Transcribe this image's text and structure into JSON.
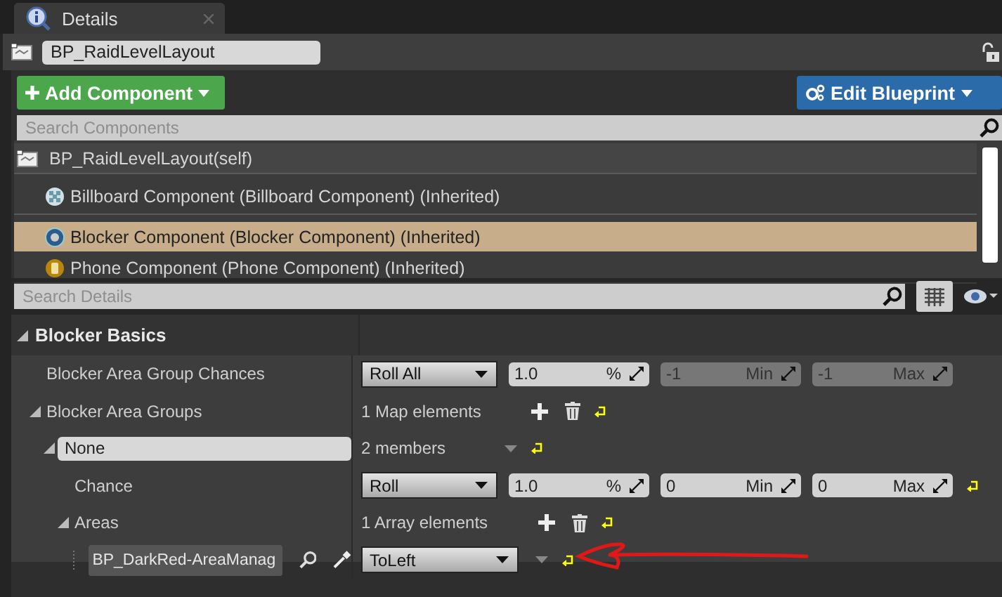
{
  "tab": {
    "title": "Details"
  },
  "actor": {
    "name": "BP_RaidLevelLayout"
  },
  "toolbar": {
    "add_button": "Add Component",
    "edit_button": "Edit Blueprint"
  },
  "component_search": {
    "placeholder": "Search Components"
  },
  "components": [
    {
      "kind": "root",
      "label": "BP_RaidLevelLayout(self)",
      "selected": false
    },
    {
      "kind": "billboard",
      "label": "Billboard Component (Billboard Component) (Inherited)",
      "selected": false
    },
    {
      "kind": "blocker",
      "label": "Blocker Component (Blocker Component) (Inherited)",
      "selected": true
    },
    {
      "kind": "phone",
      "label": "Phone Component (Phone Component) (Inherited)",
      "selected": false
    }
  ],
  "details_search": {
    "placeholder": "Search Details"
  },
  "category": {
    "label": "Blocker Basics",
    "expanded": true
  },
  "properties": [
    {
      "kind": "chances",
      "label": "Blocker Area Group Chances",
      "dropdown": "Roll All",
      "fields": [
        {
          "value": "1.0",
          "unit": "%",
          "disabled": false
        },
        {
          "value": "-1",
          "unit": "Min",
          "disabled": true
        },
        {
          "value": "-1",
          "unit": "Max",
          "disabled": true
        }
      ]
    },
    {
      "kind": "container",
      "label": "Blocker Area Groups",
      "expanded": true,
      "summary": "1 Map elements",
      "reset": true,
      "children": [
        {
          "kind": "key",
          "label": "None",
          "summary": "2 members",
          "expanded": true,
          "reset": true,
          "children": [
            {
              "kind": "chances",
              "label": "Chance",
              "dropdown": "Roll",
              "fields": [
                {
                  "value": "1.0",
                  "unit": "%",
                  "disabled": false
                },
                {
                  "value": "0",
                  "unit": "Min",
                  "disabled": false
                },
                {
                  "value": "0",
                  "unit": "Max",
                  "disabled": false
                }
              ],
              "reset": true
            },
            {
              "kind": "container",
              "label": "Areas",
              "expanded": true,
              "summary": "1 Array elements",
              "reset": true,
              "children": [
                {
                  "kind": "asset",
                  "value": "BP_DarkRed-AreaManag",
                  "dropdown": "ToLeft",
                  "reset": true
                }
              ]
            }
          ]
        }
      ]
    }
  ]
}
